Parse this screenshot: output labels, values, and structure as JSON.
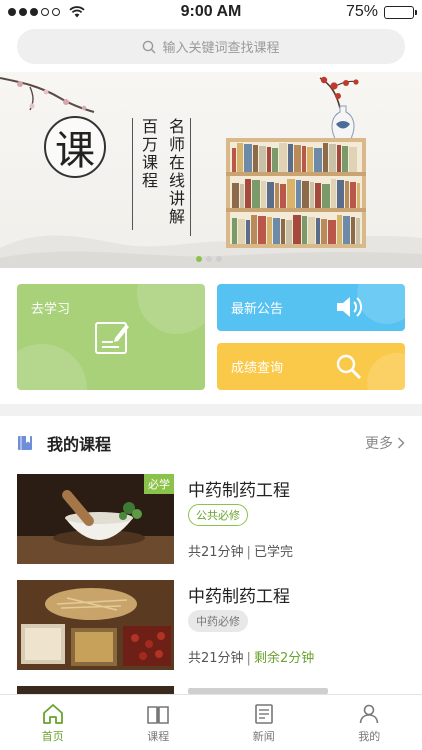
{
  "status_bar": {
    "time": "9:00 AM",
    "battery": "75%",
    "battery_level": 0.75
  },
  "search": {
    "placeholder": "输入关键词查找课程",
    "icon": "search-icon"
  },
  "banner": {
    "character": "课",
    "slogan_1": "百万课程",
    "slogan_2": "名师在线讲解",
    "page_count": 3,
    "active_page": 1
  },
  "tiles": {
    "study": {
      "label": "去学习",
      "icon": "edit-icon",
      "color": "#a8d17a"
    },
    "notice": {
      "label": "最新公告",
      "icon": "speaker-icon",
      "color": "#55c2f2"
    },
    "score": {
      "label": "成绩查询",
      "icon": "search-icon",
      "color": "#fbc94a"
    }
  },
  "my_courses": {
    "title": "我的课程",
    "more": "更多",
    "items": [
      {
        "title": "中药制药工程",
        "badge": "必学",
        "tag": "公共必修",
        "duration": "共21分钟",
        "status": "已学完"
      },
      {
        "title": "中药制药工程",
        "badge": "",
        "tag": "中药必修",
        "duration": "共21分钟",
        "status": "剩余2分钟"
      }
    ]
  },
  "tab_bar": {
    "tabs": [
      {
        "label": "首页",
        "icon": "home-icon",
        "active": true
      },
      {
        "label": "课程",
        "icon": "book-icon",
        "active": false
      },
      {
        "label": "新闻",
        "icon": "news-icon",
        "active": false
      },
      {
        "label": "我的",
        "icon": "user-icon",
        "active": false
      }
    ]
  },
  "colors": {
    "accent": "#8bc34a",
    "accent_text": "#6aa32f",
    "divider": "#f1f1f1"
  }
}
